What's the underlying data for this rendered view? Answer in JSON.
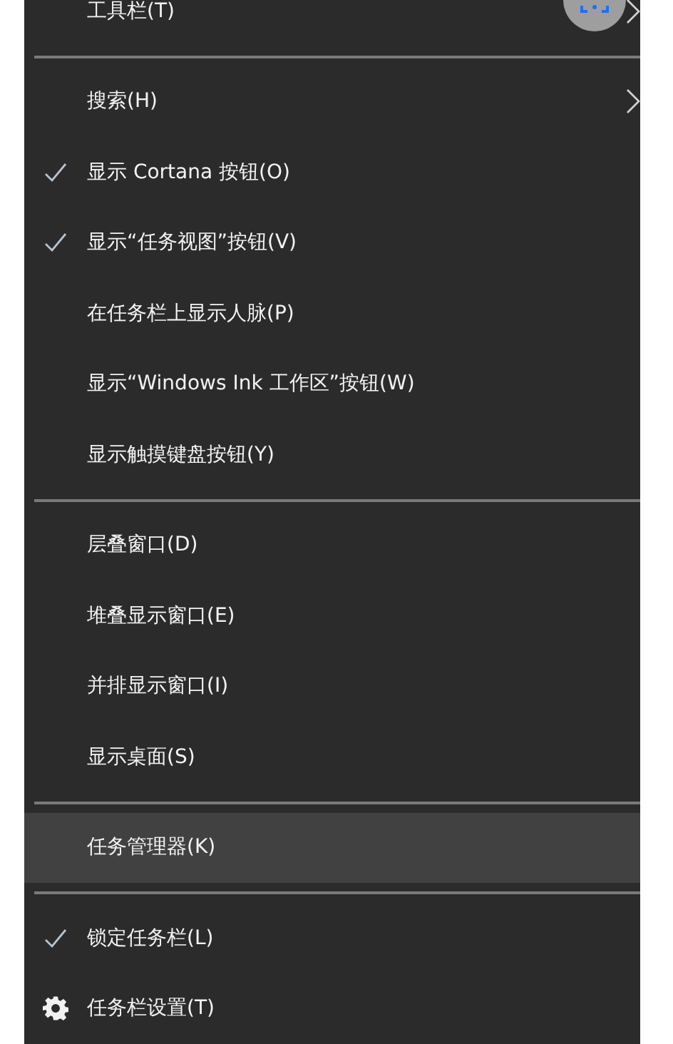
{
  "menu": {
    "items": [
      {
        "kind": "item",
        "label": "工具栏(T)",
        "checked": false,
        "selected": false,
        "submenu": true
      },
      {
        "kind": "separator"
      },
      {
        "kind": "item",
        "label": "搜索(H)",
        "checked": false,
        "selected": false,
        "submenu": true
      },
      {
        "kind": "item",
        "label": "显示 Cortana 按钮(O)",
        "checked": true,
        "selected": false,
        "submenu": false
      },
      {
        "kind": "item",
        "label": "显示“任务视图”按钮(V)",
        "checked": true,
        "selected": false,
        "submenu": false
      },
      {
        "kind": "item",
        "label": "在任务栏上显示人脉(P)",
        "checked": false,
        "selected": false,
        "submenu": false
      },
      {
        "kind": "item",
        "label": "显示“Windows Ink 工作区”按钮(W)",
        "checked": false,
        "selected": false,
        "submenu": false
      },
      {
        "kind": "item",
        "label": "显示触摸键盘按钮(Y)",
        "checked": false,
        "selected": false,
        "submenu": false
      },
      {
        "kind": "separator"
      },
      {
        "kind": "item",
        "label": "层叠窗口(D)",
        "checked": false,
        "selected": false,
        "submenu": false
      },
      {
        "kind": "item",
        "label": "堆叠显示窗口(E)",
        "checked": false,
        "selected": false,
        "submenu": false
      },
      {
        "kind": "item",
        "label": "并排显示窗口(I)",
        "checked": false,
        "selected": false,
        "submenu": false
      },
      {
        "kind": "item",
        "label": "显示桌面(S)",
        "checked": false,
        "selected": false,
        "submenu": false
      },
      {
        "kind": "separator"
      },
      {
        "kind": "item",
        "label": "任务管理器(K)",
        "checked": false,
        "selected": true,
        "submenu": false
      },
      {
        "kind": "separator"
      },
      {
        "kind": "item",
        "label": "锁定任务栏(L)",
        "checked": true,
        "selected": false,
        "submenu": false
      },
      {
        "kind": "gear-item",
        "label": "任务栏设置(T)",
        "checked": false,
        "selected": false,
        "submenu": false
      }
    ]
  }
}
